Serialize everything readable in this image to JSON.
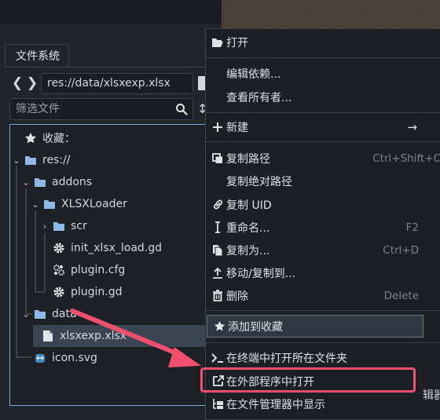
{
  "dock": {
    "title": "文件系统"
  },
  "nav": {
    "back": "❮",
    "forward": "❯"
  },
  "path": {
    "value": "res://data/xlsxexp.xlsx"
  },
  "filter": {
    "placeholder": "筛选文件"
  },
  "tree": {
    "items": [
      {
        "label": "收藏：",
        "icon": "star-icon"
      },
      {
        "label": "res://",
        "icon": "folder-icon"
      },
      {
        "label": "addons",
        "icon": "folder-icon"
      },
      {
        "label": "XLSXLoader",
        "icon": "folder-icon"
      },
      {
        "label": "scr",
        "icon": "folder-icon"
      },
      {
        "label": "init_xlsx_load.gd",
        "icon": "gear-icon"
      },
      {
        "label": "plugin.cfg",
        "icon": "cfg-gear-icon"
      },
      {
        "label": "plugin.gd",
        "icon": "gear-icon"
      },
      {
        "label": "data",
        "icon": "folder-icon"
      },
      {
        "label": "xlsxexp.xlsx",
        "icon": "file-icon",
        "selected": true
      },
      {
        "label": "icon.svg",
        "icon": "godot-icon"
      }
    ]
  },
  "menu": {
    "items": [
      {
        "label": "打开",
        "shortcut": "",
        "icon": "folder-open-icon"
      },
      {
        "label": "编辑依赖...",
        "shortcut": "",
        "icon": ""
      },
      {
        "label": "查看所有者...",
        "shortcut": "",
        "icon": ""
      },
      {
        "label": "新建",
        "shortcut": "",
        "icon": "plus-icon",
        "submenu": true
      },
      {
        "label": "复制路径",
        "shortcut": "Ctrl+Shift+C",
        "icon": "copy-icon"
      },
      {
        "label": "复制绝对路径",
        "shortcut": "",
        "icon": ""
      },
      {
        "label": "复制 UID",
        "shortcut": "",
        "icon": "link-icon"
      },
      {
        "label": "重命名...",
        "shortcut": "F2",
        "icon": "rename-icon"
      },
      {
        "label": "复制为...",
        "shortcut": "Ctrl+D",
        "icon": "duplicate-icon"
      },
      {
        "label": "移动/复制到...",
        "shortcut": "",
        "icon": "move-icon"
      },
      {
        "label": "删除",
        "shortcut": "Delete",
        "icon": "trash-icon"
      },
      {
        "label": "添加到收藏",
        "shortcut": "",
        "icon": "star-icon"
      },
      {
        "label": "在终端中打开所在文件夹",
        "shortcut": "",
        "icon": "terminal-icon"
      },
      {
        "label": "在外部程序中打开",
        "shortcut": "",
        "icon": "external-link-icon"
      },
      {
        "label": "在文件管理器中显示",
        "shortcut": "",
        "icon": "file-manager-icon"
      }
    ],
    "submenu_arrow": "→"
  },
  "edge_text": "辑器",
  "colors": {
    "accent": "#6fa8dc",
    "annotation": "#f0506e",
    "folder": "#8eb8e5"
  }
}
